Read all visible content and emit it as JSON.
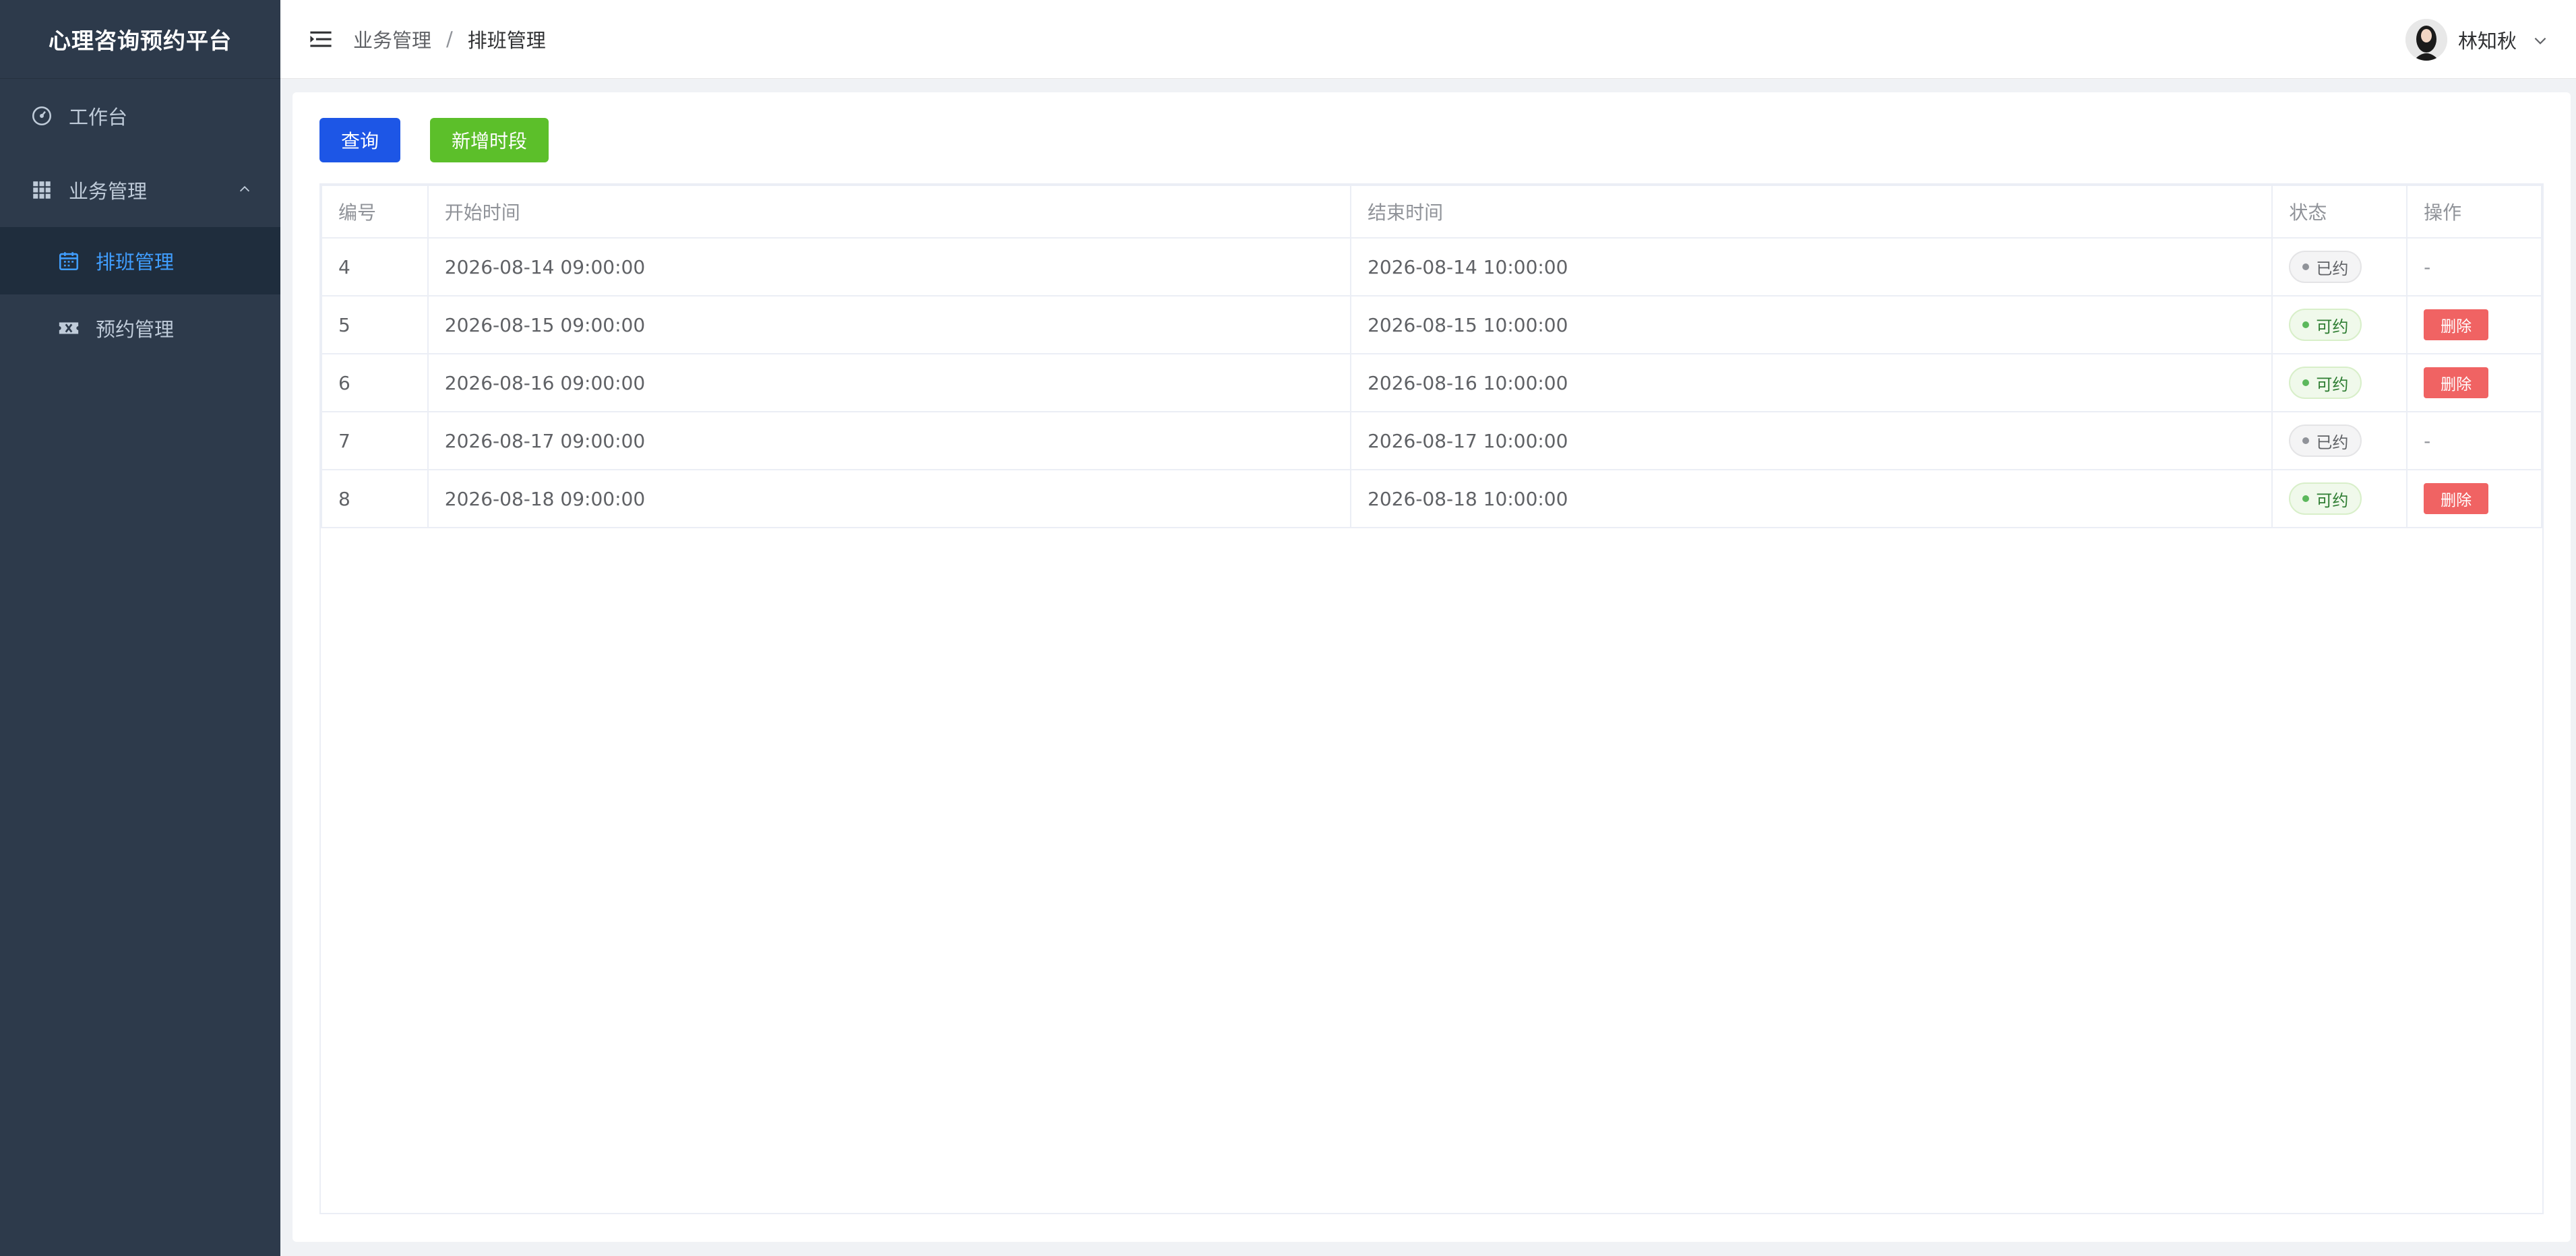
{
  "app": {
    "title": "心理咨询预约平台"
  },
  "sidebar": {
    "items": [
      {
        "label": "工作台",
        "icon": "dashboard-icon"
      },
      {
        "label": "业务管理",
        "icon": "grid-icon",
        "expanded": true,
        "children": [
          {
            "label": "排班管理",
            "icon": "calendar-icon",
            "active": true
          },
          {
            "label": "预约管理",
            "icon": "ticket-icon",
            "active": false
          }
        ]
      }
    ]
  },
  "header": {
    "breadcrumb": [
      "业务管理",
      "排班管理"
    ],
    "breadcrumb_sep": "/",
    "user_name": "林知秋"
  },
  "toolbar": {
    "query_label": "查询",
    "add_label": "新增时段"
  },
  "table": {
    "columns": [
      "编号",
      "开始时间",
      "结束时间",
      "状态",
      "操作"
    ],
    "rows": [
      {
        "id": "4",
        "start": "2026-08-14 09:00:00",
        "end": "2026-08-14 10:00:00",
        "status": "已约",
        "status_type": "booked",
        "action": "-"
      },
      {
        "id": "5",
        "start": "2026-08-15 09:00:00",
        "end": "2026-08-15 10:00:00",
        "status": "可约",
        "status_type": "available",
        "action": "删除"
      },
      {
        "id": "6",
        "start": "2026-08-16 09:00:00",
        "end": "2026-08-16 10:00:00",
        "status": "可约",
        "status_type": "available",
        "action": "删除"
      },
      {
        "id": "7",
        "start": "2026-08-17 09:00:00",
        "end": "2026-08-17 10:00:00",
        "status": "已约",
        "status_type": "booked",
        "action": "-"
      },
      {
        "id": "8",
        "start": "2026-08-18 09:00:00",
        "end": "2026-08-18 10:00:00",
        "status": "可约",
        "status_type": "available",
        "action": "删除"
      }
    ]
  },
  "colors": {
    "sidebar_bg": "#2d3a4b",
    "submenu_bg": "#1f2d3d",
    "active_text": "#409eff",
    "primary": "#1d56e6",
    "success": "#5cbf2a",
    "danger": "#f06363"
  }
}
